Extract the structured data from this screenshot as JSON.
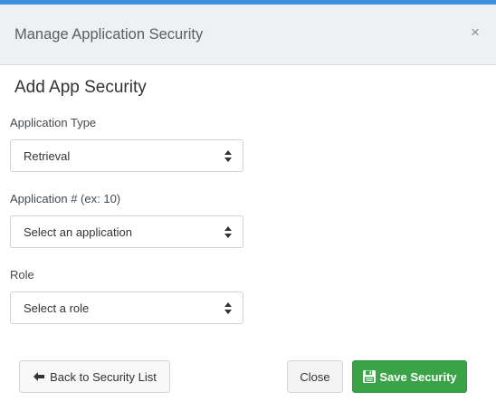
{
  "modal": {
    "title": "Manage Application Security",
    "close_glyph": "×"
  },
  "form": {
    "section_title": "Add App Security",
    "fields": [
      {
        "label": "Application Type",
        "value": "Retrieval"
      },
      {
        "label": "Application # (ex: 10)",
        "value": "Select an application"
      },
      {
        "label": "Role",
        "value": "Select a role"
      }
    ]
  },
  "footer": {
    "back_label": "Back to Security List",
    "back_icon": "arrow-left-icon",
    "close_label": "Close",
    "save_label": "Save Security",
    "save_icon": "floppy-disk-icon"
  },
  "colors": {
    "accent": "#3d8fe0",
    "header_bg": "#eef0f3",
    "save_button": "#3aa348"
  }
}
